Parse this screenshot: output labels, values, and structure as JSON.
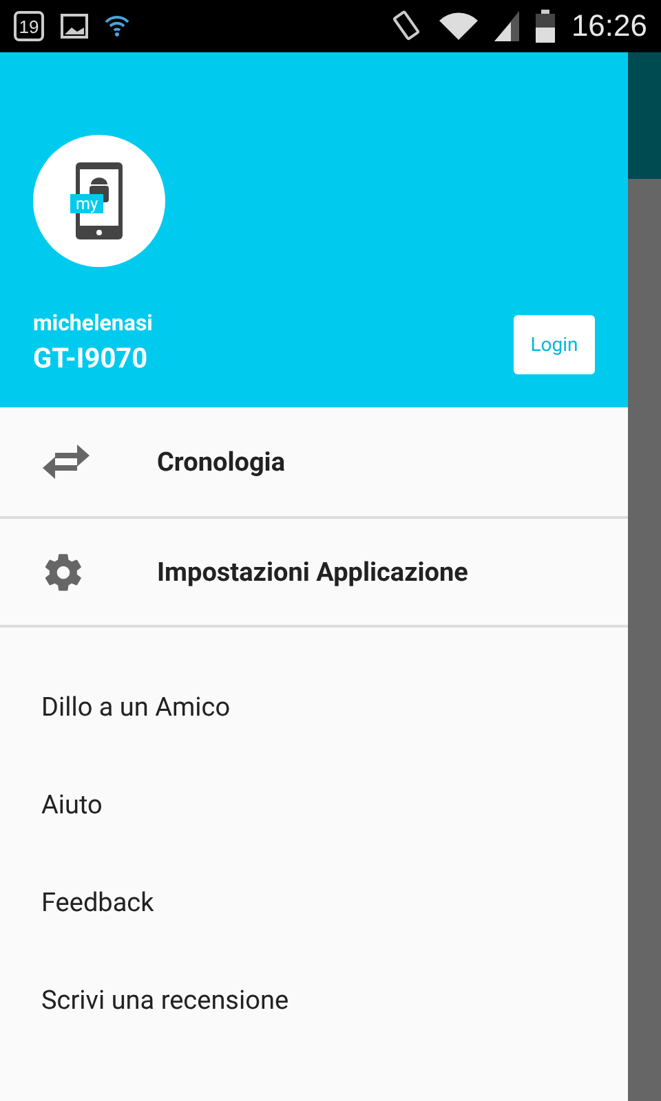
{
  "status_bar": {
    "calendar_day": "19",
    "time": "16:26"
  },
  "header": {
    "logo_text": "my",
    "username": "michelenasi",
    "device": "GT-I9070",
    "login_button": "Login"
  },
  "primary_items": [
    {
      "kind": "swap",
      "label": "Cronologia"
    },
    {
      "kind": "settings",
      "label": "Impostazioni Applicazione"
    }
  ],
  "secondary_items": [
    "Dillo a un Amico",
    "Aiuto",
    "Feedback",
    "Scrivi una recensione"
  ]
}
